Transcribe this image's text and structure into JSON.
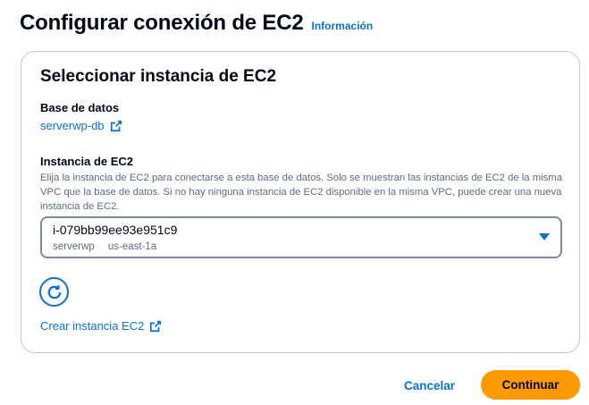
{
  "header": {
    "title": "Configurar conexión de EC2",
    "info_link": "Información"
  },
  "container": {
    "title": "Seleccionar instancia de EC2",
    "database": {
      "label": "Base de datos",
      "link_text": "serverwp-db",
      "link_icon": "external-link-icon"
    },
    "ec2_instance": {
      "label": "Instancia de EC2",
      "description": "Elija la instancia de EC2 para conectarse a esta base de datos. Solo se muestran las instancias de EC2 de la misma VPC que la base de datos. Si no hay ninguna instancia de EC2 disponible en la misma VPC, puede crear una nueva instancia de EC2.",
      "selected_value": "i-079bb99ee93e951c9",
      "tags": [
        "serverwp",
        "us-east-1a"
      ],
      "caret_icon": "caret-down-icon"
    },
    "refresh_icon": "refresh-icon",
    "create_link": "Crear instancia EC2"
  },
  "footer": {
    "cancel_label": "Cancelar",
    "continue_label": "Continuar"
  },
  "colors": {
    "link": "#0972d3",
    "primary_button": "#ff9900",
    "text": "#000716",
    "secondary_text": "#5f6b7a"
  }
}
